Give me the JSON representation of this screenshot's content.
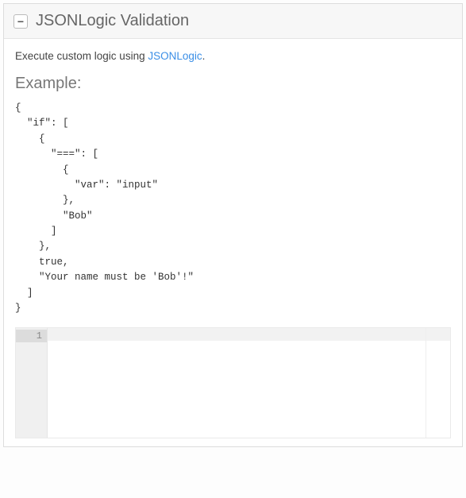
{
  "panel": {
    "collapse_glyph": "−",
    "title": "JSONLogic Validation"
  },
  "description": {
    "prefix": "Execute custom logic using ",
    "link_text": "JSONLogic",
    "suffix": "."
  },
  "example": {
    "heading": "Example:",
    "code": "{\n  \"if\": [\n    {\n      \"===\": [\n        {\n          \"var\": \"input\"\n        },\n        \"Bob\"\n      ]\n    },\n    true,\n    \"Your name must be 'Bob'!\"\n  ]\n}"
  },
  "editor": {
    "line_numbers": [
      "1"
    ],
    "content": ""
  }
}
